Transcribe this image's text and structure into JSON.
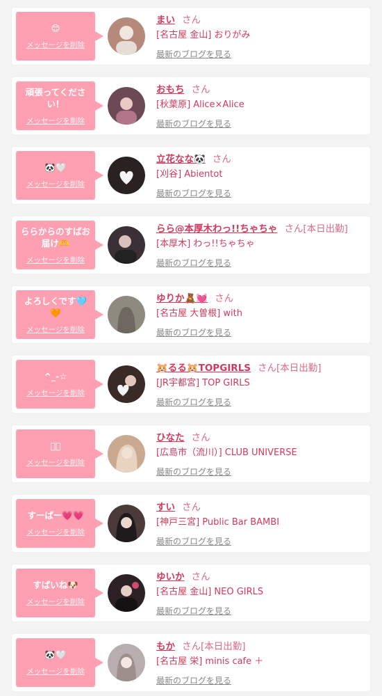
{
  "delete_label": "メッセージを削除",
  "blog_label": "最新のブログを見る",
  "san_label": "さん",
  "entries": [
    {
      "message": "😊",
      "name": "まい",
      "working": "",
      "shop": "[名古屋 金山] おりがみ",
      "avatar_color": "#b58a7a"
    },
    {
      "message": "頑張ってください！",
      "name": "おもち",
      "working": "",
      "shop": "[秋葉原] Alice×Alice",
      "avatar_color": "#6b4a55"
    },
    {
      "message": "🐼🤍",
      "name": "立花なな🐼",
      "working": "",
      "shop": "[刈谷] Abientot",
      "avatar_color": "#2a2222"
    },
    {
      "message": "ららからのすぱお届け🫶",
      "name": "らら@本厚木わっ!!ちゃちゃ",
      "working": "[本日出勤]",
      "shop": "[本厚木] わっ!!ちゃちゃ",
      "avatar_color": "#3b3035"
    },
    {
      "message": "よろしくです🩵🧡",
      "name": "ゆりか🧸💓",
      "working": "",
      "shop": "[名古屋 大曽根] with",
      "avatar_color": "#8f8a80"
    },
    {
      "message": "^_-☆",
      "name": "🐹るる🐹TOPGIRLS",
      "working": "[本日出勤]",
      "shop": "[JR宇都宮] TOP GIRLS",
      "avatar_color": "#3a2a26"
    },
    {
      "message": "ෆ゙",
      "name": "ひなた",
      "working": "",
      "shop": "[広島市（流川）] CLUB UNIVERSE",
      "avatar_color": "#c9a98f"
    },
    {
      "message": "すーぱー💗💗",
      "name": "すい",
      "working": "",
      "shop": "[神戸三宮] Public Bar BAMBI",
      "avatar_color": "#4a3a3a"
    },
    {
      "message": "すばいね🐶",
      "name": "ゆいか",
      "working": "",
      "shop": "[名古屋 金山] NEO GIRLS",
      "avatar_color": "#2c2226"
    },
    {
      "message": "🐼🤍",
      "name": "もか",
      "working": "[本日出勤]",
      "shop": "[名古屋 栄] minis cafe ＋",
      "avatar_color": "#b8aeb0"
    }
  ]
}
